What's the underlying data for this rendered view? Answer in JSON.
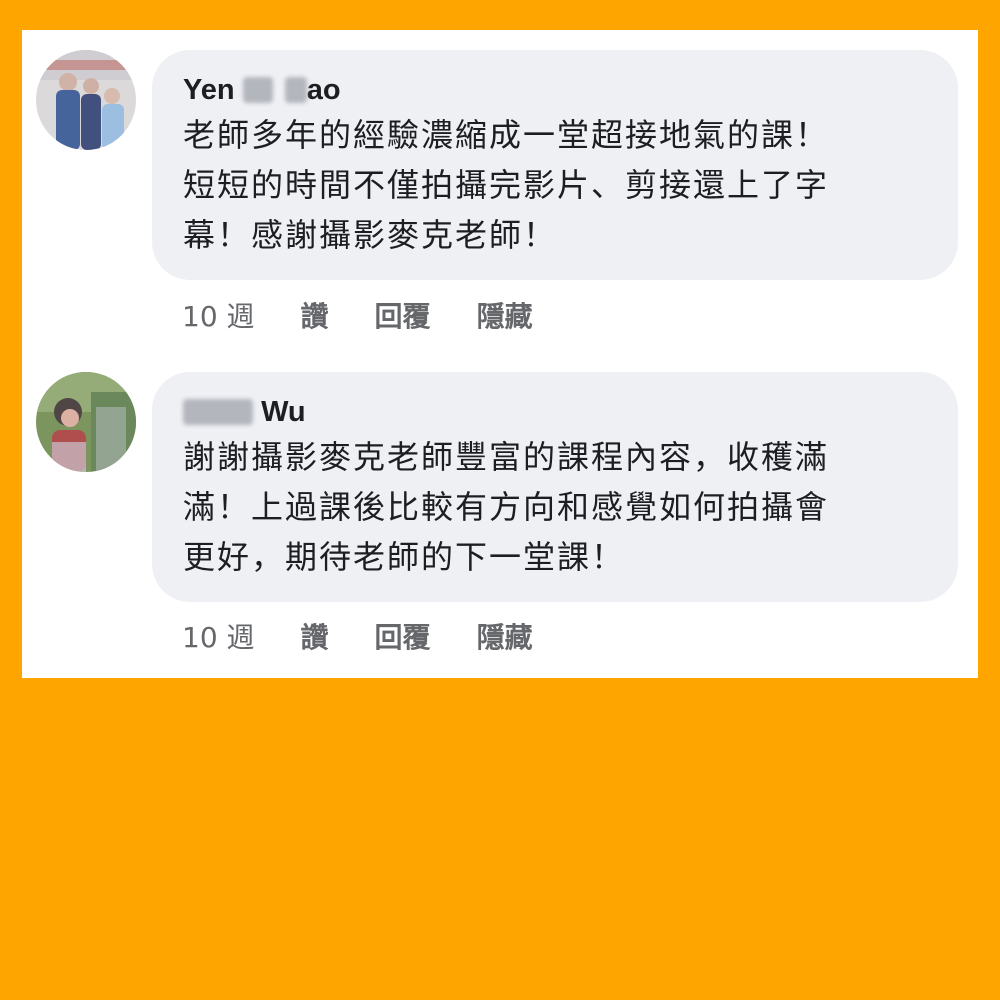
{
  "comments": [
    {
      "author_parts": [
        "Yen",
        "ao"
      ],
      "avatar": "avatar-photo-family",
      "text": "老師多年的經驗濃縮成一堂超接地氣的課！\n短短的時間不僅拍攝完影片、剪接還上了字\n幕！感謝攝影麥克老師！",
      "time": "10 週",
      "like_label": "讚",
      "reply_label": "回覆",
      "hide_label": "隱藏"
    },
    {
      "author_parts": [
        "Wu"
      ],
      "avatar": "avatar-photo-outdoor",
      "text": "謝謝攝影麥克老師豐富的課程內容，收穫滿\n滿！上過課後比較有方向和感覺如何拍攝會\n更好，期待老師的下一堂課！",
      "time": "10 週",
      "like_label": "讚",
      "reply_label": "回覆",
      "hide_label": "隱藏"
    }
  ],
  "colors": {
    "background": "#FFA500",
    "panel": "#ffffff",
    "bubble": "#eff0f4",
    "name": "#1c1e21",
    "meta": "#65676b"
  }
}
